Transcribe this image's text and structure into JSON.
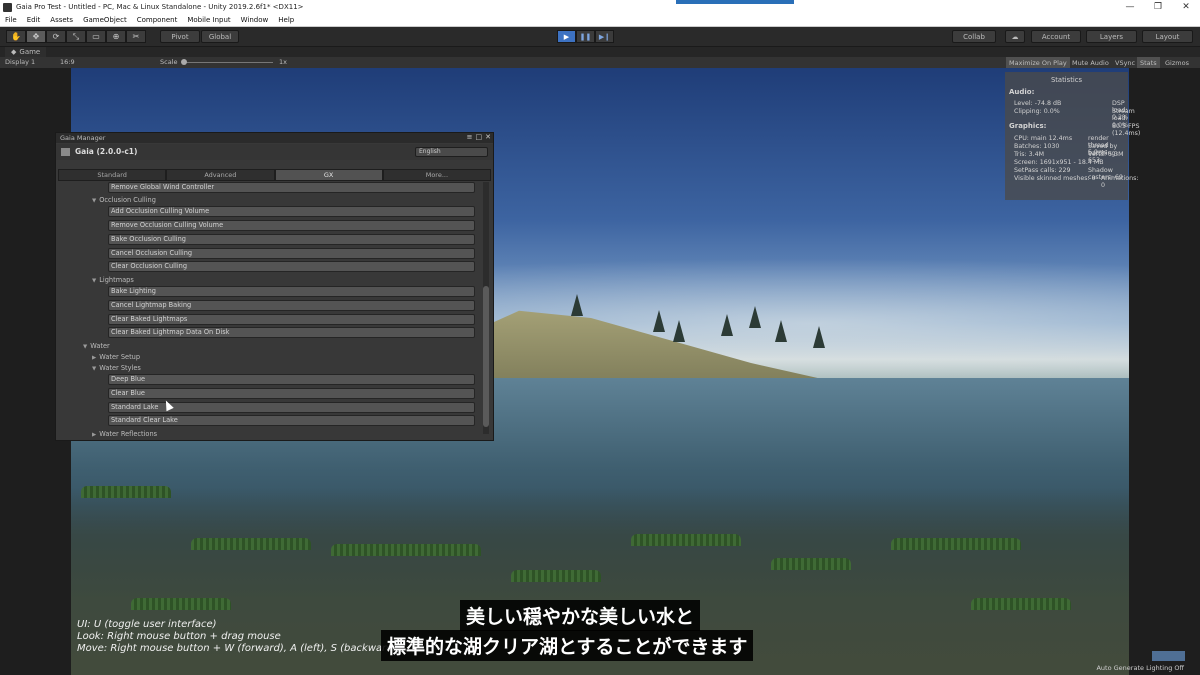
{
  "window": {
    "title": "Gaia Pro Test - Untitled - PC, Mac & Linux Standalone - Unity 2019.2.6f1* <DX11>",
    "controls": [
      "—",
      "❐",
      "✕"
    ]
  },
  "menu": [
    "File",
    "Edit",
    "Assets",
    "GameObject",
    "Component",
    "Mobile Input",
    "Window",
    "Help"
  ],
  "toolbar": {
    "tools": [
      "✋",
      "✥",
      "⟳",
      "⤡",
      "▭",
      "⊕",
      "✂"
    ],
    "pivot": "Pivot",
    "global": "Global",
    "collab": "Collab",
    "account": "Account",
    "layers": "Layers",
    "layout": "Layout"
  },
  "game_tab": {
    "label": "Game",
    "display": "Display 1",
    "aspect": "16:9",
    "scale_label": "Scale",
    "scale_value": "1x",
    "maximize": "Maximize On Play",
    "mute": "Mute Audio",
    "vsync": "VSync",
    "stats": "Stats",
    "gizmos": "Gizmos"
  },
  "statistics": {
    "title": "Statistics",
    "audio_header": "Audio:",
    "level": "Level: -74.8 dB",
    "dsp": "DSP load: 0.2%",
    "clipping": "Clipping: 0.0%",
    "stream": "Stream load: 0.0%",
    "graphics_header": "Graphics:",
    "fps": "80.5 FPS (12.4ms)",
    "cpu": "CPU: main 12.4ms",
    "render": "render thread 5.9ms",
    "batches": "Batches: 1030",
    "saved": "Saved by batching: 653",
    "tris": "Tris: 3.4M",
    "verts": "Verts: 5.3M",
    "screen": "Screen: 1691x951 - 18.4 MB",
    "setpass": "SetPass calls: 229",
    "shadow": "Shadow casters: 69",
    "skinned": "Visible skinned meshes: 0",
    "animations": "Animations: 0"
  },
  "gaia": {
    "window_title": "Gaia Manager",
    "name": "Gaia (2.0.0-c1)",
    "language": "English",
    "tabs": [
      "Standard",
      "Advanced",
      "GX",
      "More..."
    ],
    "active_tab": "GX",
    "items": {
      "remove_wind": "Remove Global Wind Controller",
      "occlusion": "Occlusion Culling",
      "add_occ": "Add Occlusion Culling Volume",
      "remove_occ": "Remove Occlusion Culling Volume",
      "bake_occ": "Bake Occlusion Culling",
      "cancel_occ": "Cancel Occlusion Culling",
      "clear_occ": "Clear Occlusion Culling",
      "lightmaps": "Lightmaps",
      "bake_light": "Bake Lighting",
      "cancel_light": "Cancel Lightmap Baking",
      "clear_light": "Clear Baked Lightmaps",
      "clear_light_disk": "Clear Baked Lightmap Data On Disk",
      "water": "Water",
      "water_setup": "Water Setup",
      "water_styles": "Water Styles",
      "deep_blue": "Deep Blue",
      "clear_blue": "Clear Blue",
      "standard_lake": "Standard Lake",
      "standard_clear_lake": "Standard Clear Lake",
      "water_reflections": "Water Reflections"
    }
  },
  "help": {
    "line1": "UI: U (toggle user interface)",
    "line2": "Look: Right mouse button + drag mouse",
    "line3": "Move: Right mouse button + W (forward), A (left), S (backwards)"
  },
  "subtitles": {
    "line1": "美しい穏やかな美しい水と",
    "line2": "標準的な湖クリア湖とすることができます"
  },
  "status": "Auto Generate Lighting Off",
  "colors": {
    "accent": "#2a6fb8",
    "play_active": "#3d72c2",
    "panel_bg": "#383838"
  }
}
